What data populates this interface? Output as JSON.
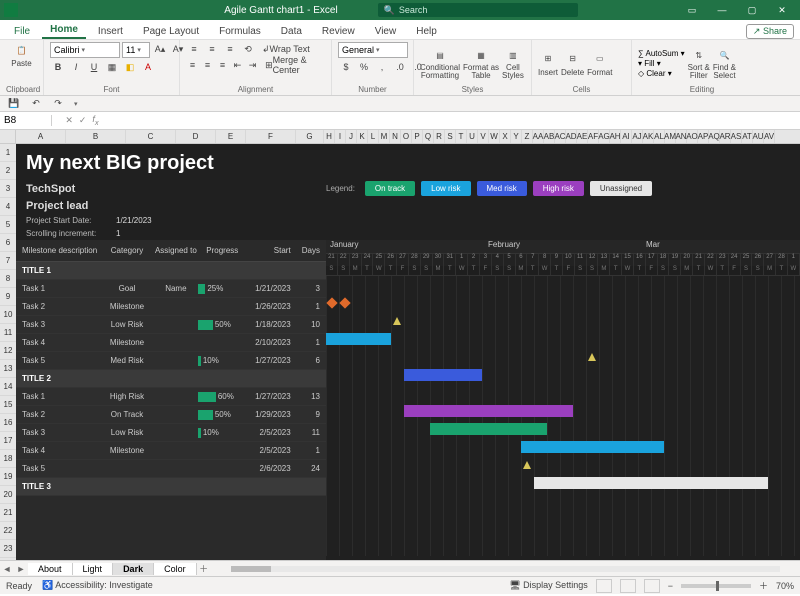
{
  "window": {
    "title": "Agile Gantt chart1 - Excel",
    "search_placeholder": "Search"
  },
  "tabs": {
    "file": "File",
    "home": "Home",
    "insert": "Insert",
    "page": "Page Layout",
    "formulas": "Formulas",
    "data": "Data",
    "review": "Review",
    "view": "View",
    "help": "Help",
    "share": "Share"
  },
  "ribbon": {
    "clipboard": {
      "label": "Clipboard",
      "paste": "Paste"
    },
    "font": {
      "label": "Font",
      "name": "Calibri",
      "size": "11"
    },
    "alignment": {
      "label": "Alignment",
      "wrap": "Wrap Text",
      "merge": "Merge & Center"
    },
    "number": {
      "label": "Number",
      "format": "General"
    },
    "styles": {
      "label": "Styles",
      "cond": "Conditional\nFormatting",
      "fastable": "Format as\nTable",
      "cell": "Cell\nStyles"
    },
    "cells": {
      "label": "Cells",
      "insert": "Insert",
      "delete": "Delete",
      "format": "Format"
    },
    "editing": {
      "label": "Editing",
      "autosum": "AutoSum",
      "fill": "Fill",
      "clear": "Clear",
      "sort": "Sort &\nFilter",
      "find": "Find &\nSelect"
    }
  },
  "namebox": "B8",
  "cols": [
    "A",
    "B",
    "C",
    "D",
    "E",
    "F",
    "G",
    "H",
    "I",
    "J",
    "K",
    "L",
    "M",
    "N",
    "O",
    "P",
    "Q",
    "R",
    "S",
    "T",
    "U",
    "V",
    "W",
    "X",
    "Y",
    "Z",
    "AA",
    "AB",
    "AC",
    "AD",
    "AE",
    "AF",
    "AG",
    "AH",
    "AI",
    "AJ",
    "AK",
    "AL",
    "AM",
    "AN",
    "AO",
    "AP",
    "AQ",
    "AR",
    "AS",
    "AT",
    "AU",
    "AV"
  ],
  "project": {
    "title": "My next BIG project",
    "company": "TechSpot",
    "lead_label": "Project lead",
    "start_label": "Project Start Date:",
    "start_value": "1/21/2023",
    "scroll_label": "Scrolling increment:",
    "scroll_value": "1"
  },
  "legend": {
    "label": "Legend:",
    "ontrack": "On track",
    "low": "Low risk",
    "med": "Med risk",
    "high": "High risk",
    "unassigned": "Unassigned"
  },
  "colors": {
    "ontrack": "#1aa36e",
    "low": "#1aa3dd",
    "med": "#3a5bdc",
    "high": "#9b3fbf",
    "unassigned": "#e6e6e6",
    "goal": "#e06a2b",
    "milestone": "#d8c65a"
  },
  "table": {
    "headers": {
      "desc": "Milestone description",
      "cat": "Category",
      "asg": "Assigned to",
      "prog": "Progress",
      "start": "Start",
      "days": "Days"
    },
    "rows": [
      {
        "type": "title",
        "desc": "TITLE 1"
      },
      {
        "desc": "Task 1",
        "cat": "Goal",
        "asg": "Name",
        "prog": 25,
        "start": "1/21/2023",
        "days": 3
      },
      {
        "desc": "Task 2",
        "cat": "Milestone",
        "asg": "",
        "prog": null,
        "start": "1/26/2023",
        "days": 1
      },
      {
        "desc": "Task 3",
        "cat": "Low Risk",
        "asg": "",
        "prog": 50,
        "start": "1/18/2023",
        "days": 10
      },
      {
        "desc": "Task 4",
        "cat": "Milestone",
        "asg": "",
        "prog": null,
        "start": "2/10/2023",
        "days": 1
      },
      {
        "desc": "Task 5",
        "cat": "Med Risk",
        "asg": "",
        "prog": 10,
        "start": "1/27/2023",
        "days": 6
      },
      {
        "type": "title",
        "desc": "TITLE 2"
      },
      {
        "desc": "Task 1",
        "cat": "High Risk",
        "asg": "",
        "prog": 60,
        "start": "1/27/2023",
        "days": 13
      },
      {
        "desc": "Task 2",
        "cat": "On Track",
        "asg": "",
        "prog": 50,
        "start": "1/29/2023",
        "days": 9
      },
      {
        "desc": "Task 3",
        "cat": "Low Risk",
        "asg": "",
        "prog": 10,
        "start": "2/5/2023",
        "days": 11
      },
      {
        "desc": "Task 4",
        "cat": "Milestone",
        "asg": "",
        "prog": null,
        "start": "2/5/2023",
        "days": 1
      },
      {
        "desc": "Task 5",
        "cat": "",
        "asg": "",
        "prog": null,
        "start": "2/6/2023",
        "days": 24
      },
      {
        "type": "title",
        "desc": "TITLE 3"
      }
    ]
  },
  "timeline": {
    "months": [
      "January",
      "February",
      "Mar"
    ],
    "days": [
      "21",
      "22",
      "23",
      "24",
      "25",
      "26",
      "27",
      "28",
      "29",
      "30",
      "31",
      "1",
      "2",
      "3",
      "4",
      "5",
      "6",
      "7",
      "8",
      "9",
      "10",
      "11",
      "12",
      "13",
      "14",
      "15",
      "16",
      "17",
      "18",
      "19",
      "20",
      "21",
      "22",
      "23",
      "24",
      "25",
      "26",
      "27",
      "28",
      "1"
    ],
    "dow": [
      "S",
      "S",
      "M",
      "T",
      "W",
      "T",
      "F",
      "S",
      "S",
      "M",
      "T",
      "W",
      "T",
      "F",
      "S",
      "S",
      "M",
      "T",
      "W",
      "T",
      "F",
      "S",
      "S",
      "M",
      "T",
      "W",
      "T",
      "F",
      "S",
      "S",
      "M",
      "T",
      "W",
      "T",
      "F",
      "S",
      "S",
      "M",
      "T",
      "W"
    ]
  },
  "chart_data": {
    "type": "gantt",
    "origin": "2023-01-21",
    "bars": [
      {
        "row": 0,
        "type": "goal",
        "start": 0,
        "len": 1
      },
      {
        "row": 0,
        "type": "goal",
        "start": 1,
        "len": 1
      },
      {
        "row": 1,
        "type": "milestone",
        "start": 5,
        "len": 1
      },
      {
        "row": 2,
        "type": "low",
        "start": 0,
        "len": 5
      },
      {
        "row": 3,
        "type": "milestone",
        "start": 20,
        "len": 1
      },
      {
        "row": 4,
        "type": "med",
        "start": 6,
        "len": 6
      },
      {
        "row": 6,
        "type": "high",
        "start": 6,
        "len": 13
      },
      {
        "row": 7,
        "type": "ontrack",
        "start": 8,
        "len": 9
      },
      {
        "row": 8,
        "type": "low",
        "start": 15,
        "len": 11
      },
      {
        "row": 9,
        "type": "milestone",
        "start": 15,
        "len": 1
      },
      {
        "row": 10,
        "type": "unassigned",
        "start": 16,
        "len": 18
      }
    ]
  },
  "sheets": {
    "nav": [
      "◄",
      "►"
    ],
    "tabs": [
      "About",
      "Light",
      "Dark",
      "Color"
    ],
    "active": "Dark",
    "add": "＋"
  },
  "status": {
    "ready": "Ready",
    "access": "Accessibility: Investigate",
    "display": "Display Settings",
    "zoom": "70%",
    "minus": "−",
    "plus": "＋"
  }
}
